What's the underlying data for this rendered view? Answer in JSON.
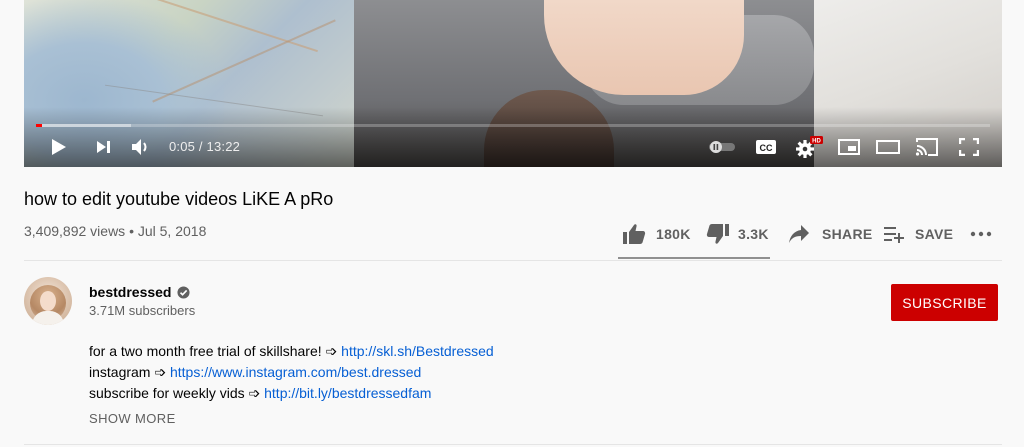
{
  "player": {
    "time_display": "0:05 / 13:22",
    "progress_played": 0.006,
    "progress_loaded": 0.1,
    "hd_badge": "HD",
    "controls": [
      "play-icon",
      "next-icon",
      "volume-icon",
      "autoplay-toggle",
      "cc-icon",
      "settings-icon",
      "miniplayer-icon",
      "theater-icon",
      "cast-icon",
      "fullscreen-icon"
    ]
  },
  "video": {
    "title": "how to edit youtube videos LiKE A pRo",
    "views_date": "3,409,892 views • Jul 5, 2018"
  },
  "actions": {
    "like_count": "180K",
    "dislike_count": "3.3K",
    "share_label": "SHARE",
    "save_label": "SAVE"
  },
  "channel": {
    "name": "bestdressed",
    "verified": true,
    "subscribers": "3.71M subscribers",
    "subscribe_label": "SUBSCRIBE"
  },
  "description": {
    "lines": [
      {
        "text": "for a two month free trial of skillshare! ➩ ",
        "link": "http://skl.sh/Bestdressed"
      },
      {
        "text": "instagram ➩ ",
        "link": "https://www.instagram.com/best.dressed"
      },
      {
        "text": "subscribe for weekly vids ➩ ",
        "link": "http://bit.ly/bestdressedfam"
      }
    ],
    "show_more": "SHOW MORE"
  },
  "colors": {
    "accent_red": "#cc0000",
    "link_blue": "#065fd4",
    "secondary_text": "#606060"
  }
}
